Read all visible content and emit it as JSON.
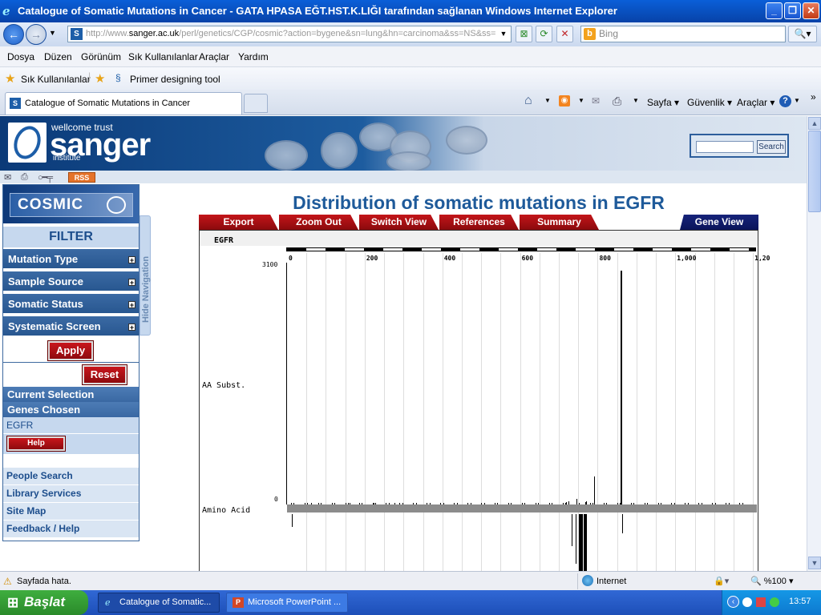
{
  "window": {
    "title": "Catalogue of Somatic Mutations in Cancer - GATA HPASA EĞT.HST.K.LIĞI tarafından sağlanan Windows Internet Explorer"
  },
  "address": {
    "url_prefix": "http://www.",
    "url_domain": "sanger.ac.uk",
    "url_rest": "/perl/genetics/CGP/cosmic?action=bygene&sn=lung&hn=carcinoma&ss=NS&ss=",
    "search_placeholder": "Bing"
  },
  "menu": [
    "Dosya",
    "Düzen",
    "Görünüm",
    "Sık Kullanılanlar",
    "Araçlar",
    "Yardım"
  ],
  "favorites": {
    "label": "Sık Kullanılanlar",
    "link": "Primer designing tool"
  },
  "tabs": {
    "active": "Catalogue of Somatic Mutations in Cancer"
  },
  "commandbar": {
    "page": "Sayfa",
    "safety": "Güvenlik",
    "tools": "Araçlar",
    "more": "»"
  },
  "site": {
    "wellcome": "wellcome trust",
    "sanger": "sanger",
    "institute": "institute",
    "search_button": "Search",
    "rss": "RSS"
  },
  "sidebar": {
    "cosmic": "COSMIC",
    "filter": "FILTER",
    "filters": [
      "Mutation Type",
      "Sample Source",
      "Somatic Status",
      "Systematic Screen"
    ],
    "apply": "Apply",
    "reset": "Reset",
    "current_selection": "Current Selection",
    "genes_chosen": "Genes Chosen",
    "gene": "EGFR",
    "help": "Help",
    "links": [
      "People Search",
      "Library Services",
      "Site Map",
      "Feedback / Help"
    ],
    "hide_nav": "Hide Navigation"
  },
  "main": {
    "title": "Distribution of somatic mutations in EGFR",
    "tabs": [
      "Export",
      "Zoom Out",
      "Switch View",
      "References",
      "Summary"
    ],
    "gene_view": "Gene View",
    "gene_label": "EGFR",
    "ruler_ticks": [
      "0",
      "200",
      "400",
      "600",
      "800",
      "1,000",
      "1,20"
    ],
    "y_max": "3100",
    "y_min": "0",
    "row_aa_subst": "AA Subst.",
    "row_amino_acid": "Amino Acid"
  },
  "chart_data": {
    "type": "bar",
    "xlabel": "",
    "ylabel": "AA Subst.",
    "xlim": [
      0,
      1210
    ],
    "ylim": [
      0,
      3100
    ],
    "bars": [
      {
        "x": 858,
        "y": 3000
      },
      {
        "x": 790,
        "y": 360
      },
      {
        "x": 746,
        "y": 70
      },
      {
        "x": 725,
        "y": 40
      },
      {
        "x": 719,
        "y": 30
      },
      {
        "x": 768,
        "y": 35
      },
      {
        "x": 770,
        "y": 40
      },
      {
        "x": 61,
        "y": 10
      },
      {
        "x": 161,
        "y": 12
      },
      {
        "x": 222,
        "y": 8
      },
      {
        "x": 263,
        "y": 12
      },
      {
        "x": 276,
        "y": 10
      },
      {
        "x": 289,
        "y": 14
      }
    ]
  },
  "status": {
    "left": "Sayfada hata.",
    "zone": "Internet",
    "zoom": "%100"
  },
  "taskbar": {
    "start": "Başlat",
    "tasks": [
      "Catalogue of Somatic...",
      "Microsoft PowerPoint ..."
    ],
    "clock": "13:57"
  }
}
